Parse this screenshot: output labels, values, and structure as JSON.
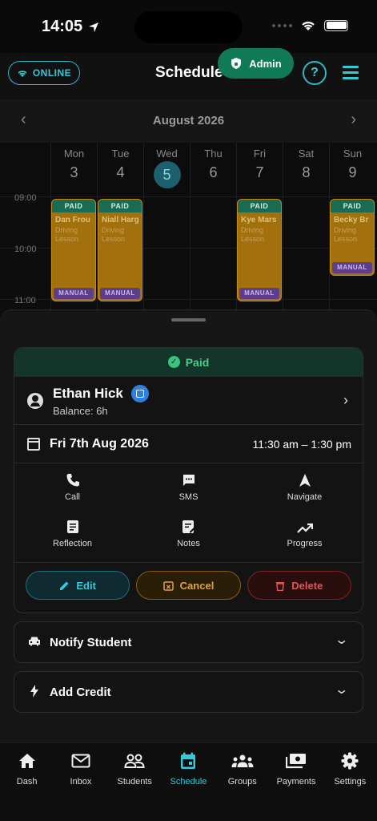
{
  "status_bar": {
    "time": "14:05"
  },
  "header": {
    "online_label": "ONLINE",
    "title": "Schedule",
    "admin_label": "Admin",
    "help_label": "?"
  },
  "calendar": {
    "month": "August 2026",
    "days": [
      {
        "name": "Mon",
        "date": "3"
      },
      {
        "name": "Tue",
        "date": "4"
      },
      {
        "name": "Wed",
        "date": "5"
      },
      {
        "name": "Thu",
        "date": "6"
      },
      {
        "name": "Fri",
        "date": "7"
      },
      {
        "name": "Sat",
        "date": "8"
      },
      {
        "name": "Sun",
        "date": "9"
      }
    ],
    "today_index": 2,
    "times": [
      "09:00",
      "10:00",
      "11:00"
    ],
    "events": [
      {
        "status": "PAID",
        "name": "Dan Frou",
        "desc": "Driving Lesson",
        "tag": "MANUAL"
      },
      {
        "status": "PAID",
        "name": "Niall Harg",
        "desc": "Driving Lesson",
        "tag": "MANUAL"
      },
      {
        "status": "PAID",
        "name": "Kye Mars",
        "desc": "Driving Lesson",
        "tag": "MANUAL"
      },
      {
        "status": "PAID",
        "name": "Becky Br",
        "desc": "Driving Lesson",
        "tag": "MANUAL"
      }
    ]
  },
  "booking": {
    "status": "Paid",
    "student_name": "Ethan Hick",
    "balance": "Balance: 6h",
    "date": "Fri 7th Aug 2026",
    "time": "11:30 am – 1:30 pm",
    "actions": {
      "call": "Call",
      "sms": "SMS",
      "navigate": "Navigate",
      "reflection": "Reflection",
      "notes": "Notes",
      "progress": "Progress"
    },
    "buttons": {
      "edit": "Edit",
      "cancel": "Cancel",
      "delete": "Delete"
    }
  },
  "accordions": {
    "notify": "Notify Student",
    "credit": "Add Credit"
  },
  "tabs": {
    "dash": "Dash",
    "inbox": "Inbox",
    "students": "Students",
    "schedule": "Schedule",
    "groups": "Groups",
    "payments": "Payments",
    "settings": "Settings"
  },
  "colors": {
    "accent": "#38c9d8",
    "paid_green": "#4ccc8e",
    "event_orange": "#a3700e",
    "manual_purple": "#5e3d8a",
    "delete_red": "#e05555",
    "cancel_amber": "#e3a23a"
  }
}
